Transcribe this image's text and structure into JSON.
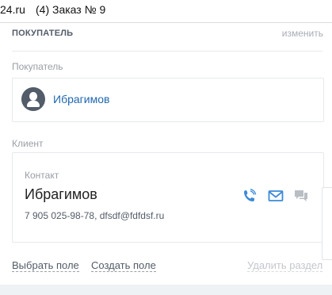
{
  "titlebar": {
    "domain_fragment": "24.ru",
    "tab_title": "(4) Заказ № 9"
  },
  "buyer_section": {
    "title": "ПОКУПАТЕЛЬ",
    "edit_label": "изменить",
    "buyer_label": "Покупатель",
    "buyer_name": "Ибрагимов",
    "client_label": "Клиент"
  },
  "client": {
    "contact_label": "Контакт",
    "contact_name": "Ибрагимов",
    "contact_info": "7 905 025-98-78, dfsdf@fdfdsf.ru",
    "actions": [
      {
        "icon": "phone-icon",
        "color": "#2fc6f6"
      },
      {
        "icon": "email-icon",
        "color": "#2fc6f6"
      },
      {
        "icon": "chat-icon",
        "color": "#a8adb4"
      }
    ]
  },
  "footer": {
    "choose_field": "Выбрать поле",
    "create_field": "Создать поле",
    "delete_section": "Удалить раздел"
  }
}
